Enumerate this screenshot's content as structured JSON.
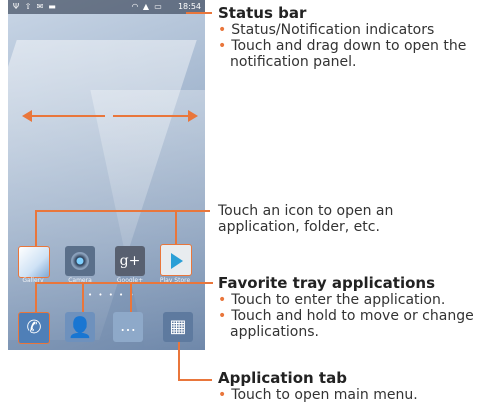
{
  "status_bar": {
    "time": "18:54"
  },
  "home_screen": {
    "apps": [
      {
        "label": "Gallery",
        "icon": "gallery-icon"
      },
      {
        "label": "Camera",
        "icon": "camera-icon"
      },
      {
        "label": "Google+",
        "icon": "google-plus-icon"
      },
      {
        "label": "Play Store",
        "icon": "play-store-icon"
      }
    ],
    "favorites": [
      {
        "icon": "phone-icon"
      },
      {
        "icon": "contacts-icon"
      },
      {
        "icon": "messaging-icon"
      }
    ],
    "app_tab_icon": "app-grid-icon"
  },
  "annotations": {
    "status_bar": {
      "title": "Status bar",
      "bullets": [
        "Status/Notification indicators",
        "Touch and drag down to open the",
        "notification panel."
      ]
    },
    "icon_hint": {
      "lines": [
        "Touch an icon to open an",
        "application, folder, etc."
      ]
    },
    "favorites": {
      "title": "Favorite tray applications",
      "bullets": [
        "Touch to enter the application.",
        "Touch and hold to move or change",
        "applications."
      ]
    },
    "app_tab": {
      "title": "Application tab",
      "bullets": [
        "Touch to open main menu."
      ]
    }
  },
  "colors": {
    "accent": "#e9763b"
  }
}
